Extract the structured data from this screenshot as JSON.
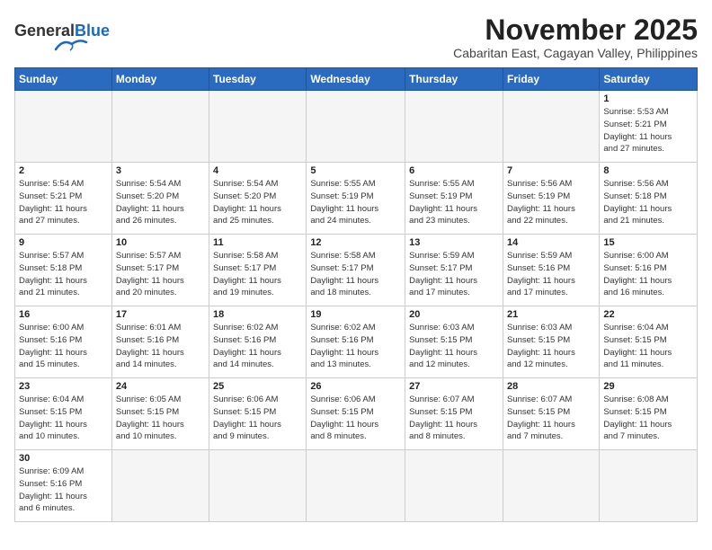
{
  "header": {
    "logo_general": "General",
    "logo_blue": "Blue",
    "month_title": "November 2025",
    "location": "Cabaritan East, Cagayan Valley, Philippines"
  },
  "days_of_week": [
    "Sunday",
    "Monday",
    "Tuesday",
    "Wednesday",
    "Thursday",
    "Friday",
    "Saturday"
  ],
  "weeks": [
    [
      {
        "day": "",
        "info": ""
      },
      {
        "day": "",
        "info": ""
      },
      {
        "day": "",
        "info": ""
      },
      {
        "day": "",
        "info": ""
      },
      {
        "day": "",
        "info": ""
      },
      {
        "day": "",
        "info": ""
      },
      {
        "day": "1",
        "info": "Sunrise: 5:53 AM\nSunset: 5:21 PM\nDaylight: 11 hours\nand 27 minutes."
      }
    ],
    [
      {
        "day": "2",
        "info": "Sunrise: 5:54 AM\nSunset: 5:21 PM\nDaylight: 11 hours\nand 27 minutes."
      },
      {
        "day": "3",
        "info": "Sunrise: 5:54 AM\nSunset: 5:20 PM\nDaylight: 11 hours\nand 26 minutes."
      },
      {
        "day": "4",
        "info": "Sunrise: 5:54 AM\nSunset: 5:20 PM\nDaylight: 11 hours\nand 25 minutes."
      },
      {
        "day": "5",
        "info": "Sunrise: 5:55 AM\nSunset: 5:19 PM\nDaylight: 11 hours\nand 24 minutes."
      },
      {
        "day": "6",
        "info": "Sunrise: 5:55 AM\nSunset: 5:19 PM\nDaylight: 11 hours\nand 23 minutes."
      },
      {
        "day": "7",
        "info": "Sunrise: 5:56 AM\nSunset: 5:19 PM\nDaylight: 11 hours\nand 22 minutes."
      },
      {
        "day": "8",
        "info": "Sunrise: 5:56 AM\nSunset: 5:18 PM\nDaylight: 11 hours\nand 21 minutes."
      }
    ],
    [
      {
        "day": "9",
        "info": "Sunrise: 5:57 AM\nSunset: 5:18 PM\nDaylight: 11 hours\nand 21 minutes."
      },
      {
        "day": "10",
        "info": "Sunrise: 5:57 AM\nSunset: 5:17 PM\nDaylight: 11 hours\nand 20 minutes."
      },
      {
        "day": "11",
        "info": "Sunrise: 5:58 AM\nSunset: 5:17 PM\nDaylight: 11 hours\nand 19 minutes."
      },
      {
        "day": "12",
        "info": "Sunrise: 5:58 AM\nSunset: 5:17 PM\nDaylight: 11 hours\nand 18 minutes."
      },
      {
        "day": "13",
        "info": "Sunrise: 5:59 AM\nSunset: 5:17 PM\nDaylight: 11 hours\nand 17 minutes."
      },
      {
        "day": "14",
        "info": "Sunrise: 5:59 AM\nSunset: 5:16 PM\nDaylight: 11 hours\nand 17 minutes."
      },
      {
        "day": "15",
        "info": "Sunrise: 6:00 AM\nSunset: 5:16 PM\nDaylight: 11 hours\nand 16 minutes."
      }
    ],
    [
      {
        "day": "16",
        "info": "Sunrise: 6:00 AM\nSunset: 5:16 PM\nDaylight: 11 hours\nand 15 minutes."
      },
      {
        "day": "17",
        "info": "Sunrise: 6:01 AM\nSunset: 5:16 PM\nDaylight: 11 hours\nand 14 minutes."
      },
      {
        "day": "18",
        "info": "Sunrise: 6:02 AM\nSunset: 5:16 PM\nDaylight: 11 hours\nand 14 minutes."
      },
      {
        "day": "19",
        "info": "Sunrise: 6:02 AM\nSunset: 5:16 PM\nDaylight: 11 hours\nand 13 minutes."
      },
      {
        "day": "20",
        "info": "Sunrise: 6:03 AM\nSunset: 5:15 PM\nDaylight: 11 hours\nand 12 minutes."
      },
      {
        "day": "21",
        "info": "Sunrise: 6:03 AM\nSunset: 5:15 PM\nDaylight: 11 hours\nand 12 minutes."
      },
      {
        "day": "22",
        "info": "Sunrise: 6:04 AM\nSunset: 5:15 PM\nDaylight: 11 hours\nand 11 minutes."
      }
    ],
    [
      {
        "day": "23",
        "info": "Sunrise: 6:04 AM\nSunset: 5:15 PM\nDaylight: 11 hours\nand 10 minutes."
      },
      {
        "day": "24",
        "info": "Sunrise: 6:05 AM\nSunset: 5:15 PM\nDaylight: 11 hours\nand 10 minutes."
      },
      {
        "day": "25",
        "info": "Sunrise: 6:06 AM\nSunset: 5:15 PM\nDaylight: 11 hours\nand 9 minutes."
      },
      {
        "day": "26",
        "info": "Sunrise: 6:06 AM\nSunset: 5:15 PM\nDaylight: 11 hours\nand 8 minutes."
      },
      {
        "day": "27",
        "info": "Sunrise: 6:07 AM\nSunset: 5:15 PM\nDaylight: 11 hours\nand 8 minutes."
      },
      {
        "day": "28",
        "info": "Sunrise: 6:07 AM\nSunset: 5:15 PM\nDaylight: 11 hours\nand 7 minutes."
      },
      {
        "day": "29",
        "info": "Sunrise: 6:08 AM\nSunset: 5:15 PM\nDaylight: 11 hours\nand 7 minutes."
      }
    ],
    [
      {
        "day": "30",
        "info": "Sunrise: 6:09 AM\nSunset: 5:16 PM\nDaylight: 11 hours\nand 6 minutes."
      },
      {
        "day": "",
        "info": ""
      },
      {
        "day": "",
        "info": ""
      },
      {
        "day": "",
        "info": ""
      },
      {
        "day": "",
        "info": ""
      },
      {
        "day": "",
        "info": ""
      },
      {
        "day": "",
        "info": ""
      }
    ]
  ]
}
